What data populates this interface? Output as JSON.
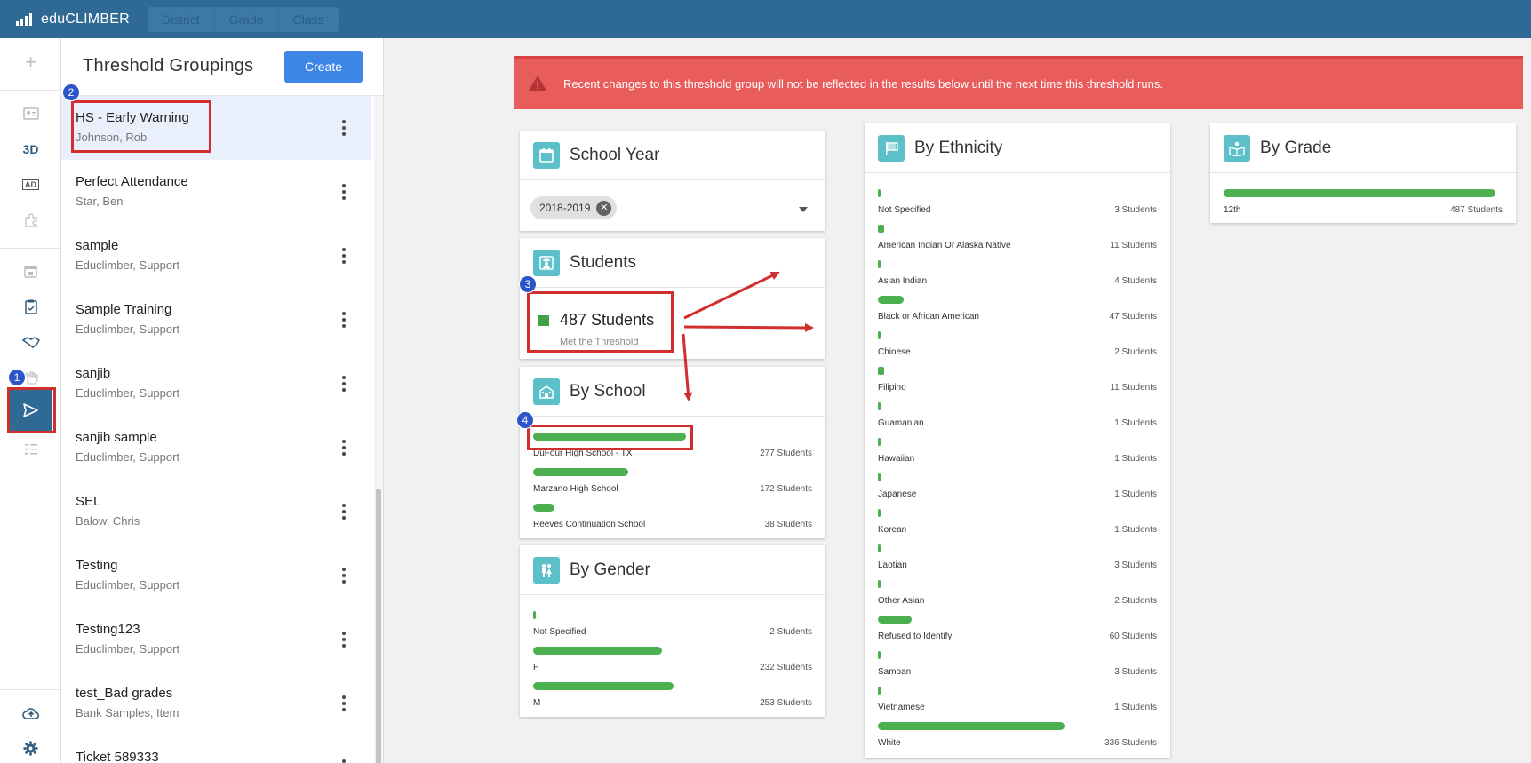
{
  "app": {
    "name": "eduCLIMBER"
  },
  "top_tabs": [
    "District",
    "Grade",
    "Class"
  ],
  "rail": {
    "items": [
      {
        "name": "add-icon",
        "label": ""
      },
      {
        "name": "id-card-icon",
        "label": ""
      },
      {
        "name": "3d-icon",
        "label": "3D"
      },
      {
        "name": "ad-icon",
        "label": "AD"
      },
      {
        "name": "puzzle-icon",
        "label": ""
      },
      {
        "name": "calendar-icon",
        "label": ""
      },
      {
        "name": "clipboard-icon",
        "label": ""
      },
      {
        "name": "handshake-icon",
        "label": ""
      },
      {
        "name": "hand-icon",
        "label": ""
      },
      {
        "name": "send-icon",
        "label": ""
      },
      {
        "name": "checklist-icon",
        "label": ""
      },
      {
        "name": "cloud-upload-icon",
        "label": ""
      },
      {
        "name": "gear-icon",
        "label": ""
      }
    ]
  },
  "panel": {
    "title": "Threshold Groupings",
    "create_label": "Create",
    "items": [
      {
        "name": "HS - Early Warning",
        "owner": "Johnson, Rob",
        "selected": true
      },
      {
        "name": "Perfect Attendance",
        "owner": "Star, Ben"
      },
      {
        "name": "sample",
        "owner": "Educlimber, Support"
      },
      {
        "name": "Sample Training",
        "owner": "Educlimber, Support"
      },
      {
        "name": "sanjib",
        "owner": "Educlimber, Support"
      },
      {
        "name": "sanjib sample",
        "owner": "Educlimber, Support"
      },
      {
        "name": "SEL",
        "owner": "Balow, Chris"
      },
      {
        "name": "Testing",
        "owner": "Educlimber, Support"
      },
      {
        "name": "Testing123",
        "owner": "Educlimber, Support"
      },
      {
        "name": "test_Bad grades",
        "owner": "Bank Samples, Item"
      },
      {
        "name": "Ticket 589333",
        "owner": ""
      }
    ]
  },
  "banner": {
    "text": "Recent changes to this threshold group will not be reflected in the results below until the next time this threshold runs."
  },
  "school_year": {
    "title": "School Year",
    "chip": "2018-2019",
    "chip_remove": "✕"
  },
  "students": {
    "title": "Students",
    "count": "487 Students",
    "subtitle": "Met the Threshold"
  },
  "by_school": {
    "title": "By School",
    "rows": [
      {
        "label": "DuFour High School - TX",
        "count": "277 Students",
        "fraction": 1.0
      },
      {
        "label": "Marzano High School",
        "count": "172 Students",
        "fraction": 0.62
      },
      {
        "label": "Reeves Continuation School",
        "count": "38 Students",
        "fraction": 0.14
      }
    ]
  },
  "by_gender": {
    "title": "By Gender",
    "rows": [
      {
        "label": "Not Specified",
        "count": "2 Students",
        "fraction": 0.01
      },
      {
        "label": "F",
        "count": "232 Students",
        "fraction": 0.92
      },
      {
        "label": "M",
        "count": "253 Students",
        "fraction": 1.0
      }
    ]
  },
  "by_ethnicity": {
    "title": "By Ethnicity",
    "rows": [
      {
        "label": "Not Specified",
        "count": "3 Students",
        "fraction": 0.009
      },
      {
        "label": "American Indian Or Alaska Native",
        "count": "11 Students",
        "fraction": 0.033
      },
      {
        "label": "Asian Indian",
        "count": "4 Students",
        "fraction": 0.012
      },
      {
        "label": "Black or African American",
        "count": "47 Students",
        "fraction": 0.14
      },
      {
        "label": "Chinese",
        "count": "2 Students",
        "fraction": 0.006
      },
      {
        "label": "Filipino",
        "count": "11 Students",
        "fraction": 0.033
      },
      {
        "label": "Guamanian",
        "count": "1 Students",
        "fraction": 0.003
      },
      {
        "label": "Hawaiian",
        "count": "1 Students",
        "fraction": 0.003
      },
      {
        "label": "Japanese",
        "count": "1 Students",
        "fraction": 0.003
      },
      {
        "label": "Korean",
        "count": "1 Students",
        "fraction": 0.003
      },
      {
        "label": "Laotian",
        "count": "3 Students",
        "fraction": 0.009
      },
      {
        "label": "Other Asian",
        "count": "2 Students",
        "fraction": 0.006
      },
      {
        "label": "Refused to Identify",
        "count": "60 Students",
        "fraction": 0.179
      },
      {
        "label": "Samoan",
        "count": "3 Students",
        "fraction": 0.009
      },
      {
        "label": "Vietnamese",
        "count": "1 Students",
        "fraction": 0.003
      },
      {
        "label": "White",
        "count": "336 Students",
        "fraction": 1.0
      }
    ]
  },
  "by_grade": {
    "title": "By Grade",
    "rows": [
      {
        "label": "12th",
        "count": "487 Students",
        "fraction": 1.0
      }
    ]
  },
  "annotations": [
    "1",
    "2",
    "3",
    "4"
  ],
  "colors": {
    "topbar": "#2e6a94",
    "accent": "#3d86e6",
    "banner": "#e85c5c",
    "bar": "#4caf50",
    "icon_tile": "#5bc0c9",
    "annotation": "#d12e2e",
    "badge": "#2d54c9"
  }
}
